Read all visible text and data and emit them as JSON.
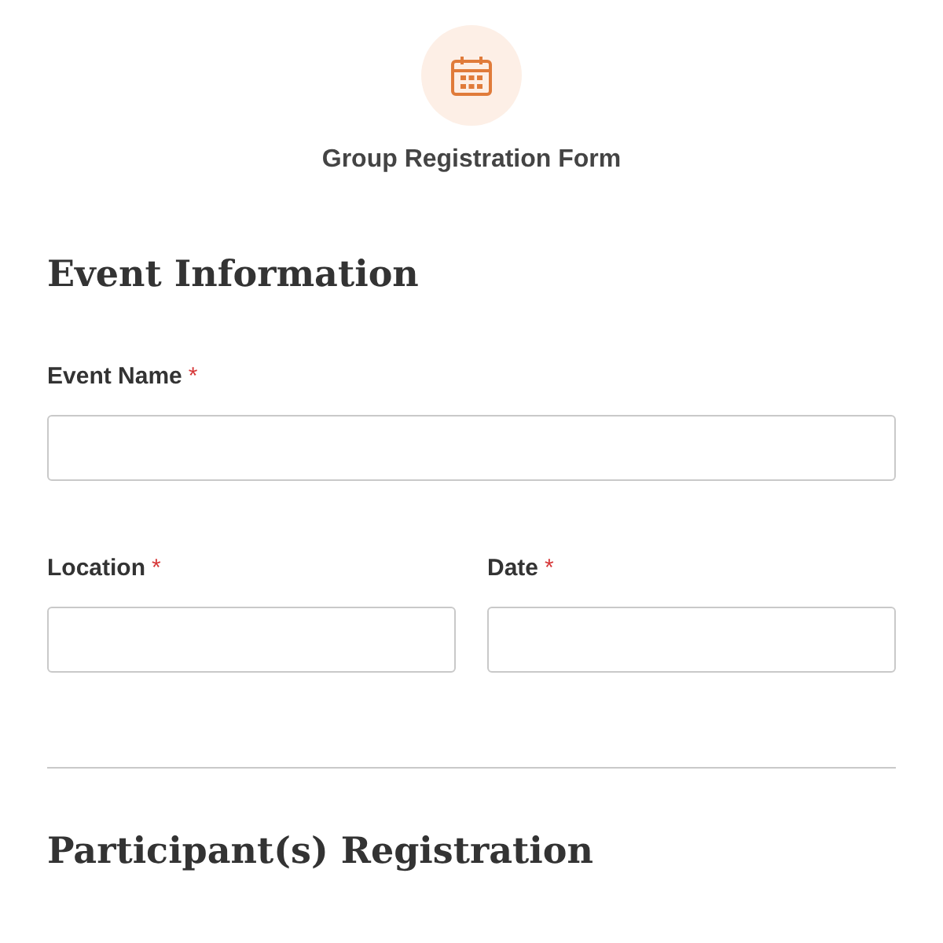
{
  "form": {
    "title": "Group Registration Form"
  },
  "sections": [
    {
      "heading": "Event Information",
      "rows": [
        [
          {
            "label": "Event Name",
            "asterisk": "*"
          }
        ],
        [
          {
            "label": "Location",
            "asterisk": "*"
          },
          {
            "label": "Date",
            "asterisk": "*"
          }
        ]
      ]
    },
    {
      "heading": "Participant(s) Registration"
    }
  ]
}
